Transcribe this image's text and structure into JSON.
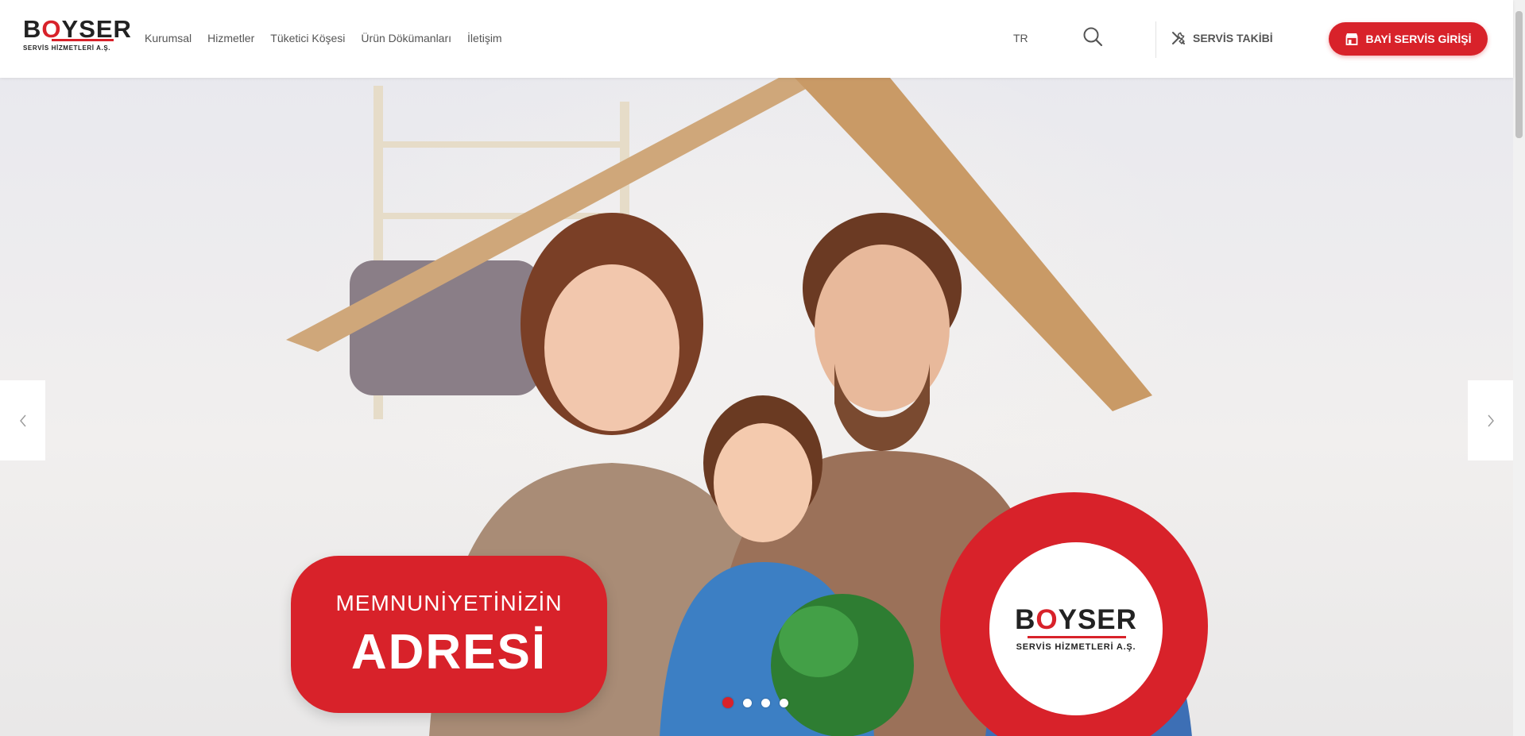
{
  "brand": {
    "logo_wordmark_start": "B",
    "logo_wordmark_o": "O",
    "logo_wordmark_end": "YSER",
    "logo_subtitle": "SERVİS HİZMETLERİ A.Ş.",
    "accent_color": "#d8222a"
  },
  "nav": {
    "items": [
      {
        "label": "Kurumsal"
      },
      {
        "label": "Hizmetler"
      },
      {
        "label": "Tüketici Köşesi"
      },
      {
        "label": "Ürün Dökümanları"
      },
      {
        "label": "İletişim"
      }
    ]
  },
  "header": {
    "language": "TR",
    "search_icon": "search-icon",
    "servis_takibi_label": "SERVİS TAKİBİ",
    "servis_takibi_icon": "tools-icon",
    "bayi_button_label": "BAYİ SERVİS GİRİŞİ",
    "bayi_button_icon": "store-icon"
  },
  "slider": {
    "headline_small": "MEMNUNİYETİNİZİN",
    "headline_big": "ADRESİ",
    "badge_wordmark_start": "B",
    "badge_wordmark_o": "O",
    "badge_wordmark_end": "YSER",
    "badge_subtitle": "SERVİS HİZMETLERİ A.Ş.",
    "slide_count": 4,
    "active_slide": 1,
    "prev_icon": "chevron-left-icon",
    "next_icon": "chevron-right-icon"
  }
}
